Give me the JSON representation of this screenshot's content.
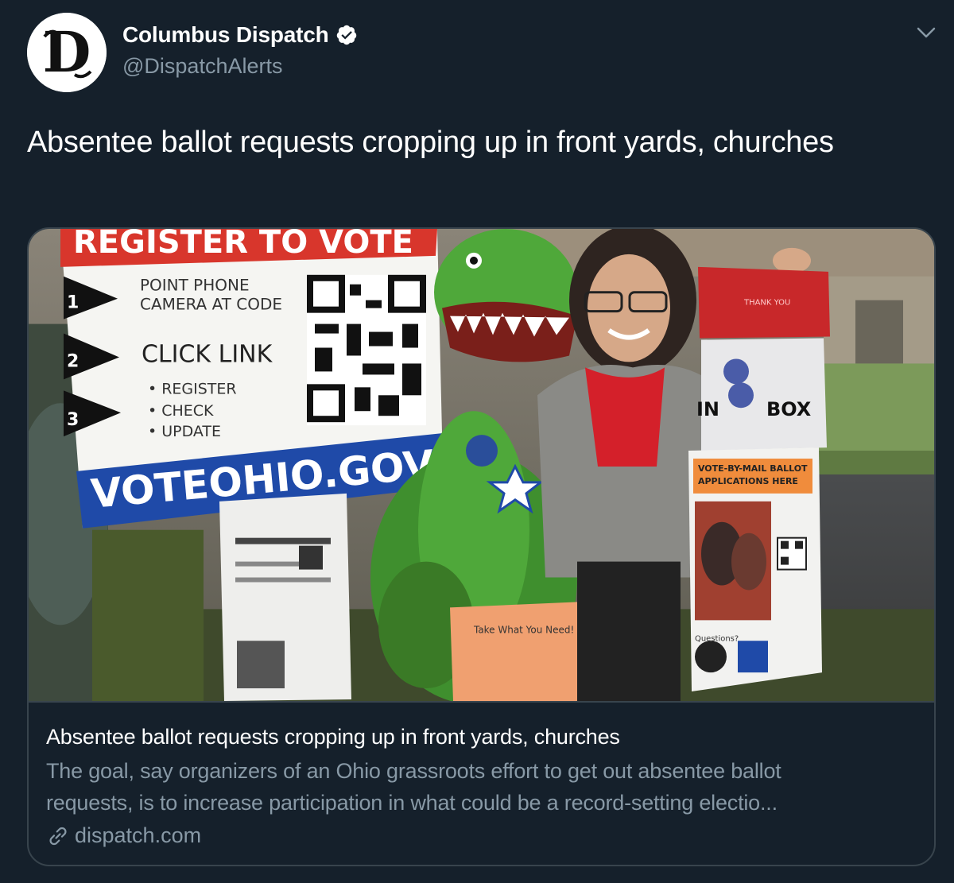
{
  "author": {
    "display_name": "Columbus Dispatch",
    "handle": "@DispatchAlerts",
    "avatar_icon": "dispatch-d-logo",
    "verified_icon": "verified-badge-icon",
    "logo_letter": "D"
  },
  "menu": {
    "icon": "chevron-down-icon"
  },
  "tweet": {
    "text": "Absentee ballot requests cropping up in front yards, churches"
  },
  "card": {
    "image_texts": {
      "sign_banner": "REGISTER TO VOTE",
      "step1": "POINT PHONE CAMERA AT CODE",
      "step1_line1": "POINT PHONE",
      "step1_line2": "CAMERA AT CODE",
      "step2": "CLICK LINK",
      "bullets": [
        "• REGISTER",
        "• CHECK",
        "• UPDATE"
      ],
      "num1": "1",
      "num2": "2",
      "num3": "3",
      "sign_url": "VOTEOHIO.GOV",
      "box_label": "BOX",
      "box_prefix": "IN",
      "mail_sign": "VOTE-BY-MAIL BALLOT APPLICATIONS HERE",
      "mail_sign_line1": "VOTE-BY-MAIL BALLOT",
      "mail_sign_line2": "APPLICATIONS HERE",
      "flyer": "Take What You Need!",
      "questions": "Questions?",
      "mailbox_lid": "THANK YOU"
    },
    "title": "Absentee ballot requests cropping up in front yards, churches",
    "description_line1": "The goal, say organizers of an Ohio grassroots effort to get out absentee ballot",
    "description_line2": "requests, is to increase participation in what could be a record-setting electio...",
    "link_icon": "link-icon",
    "domain": "dispatch.com"
  },
  "colors": {
    "background": "#15202b",
    "border": "#38444d",
    "secondary_text": "#8899a6",
    "sign_red": "#d8362c",
    "sign_blue": "#1f4aa8",
    "dino_green": "#4fa83a",
    "shirt_red": "#d4202a"
  }
}
